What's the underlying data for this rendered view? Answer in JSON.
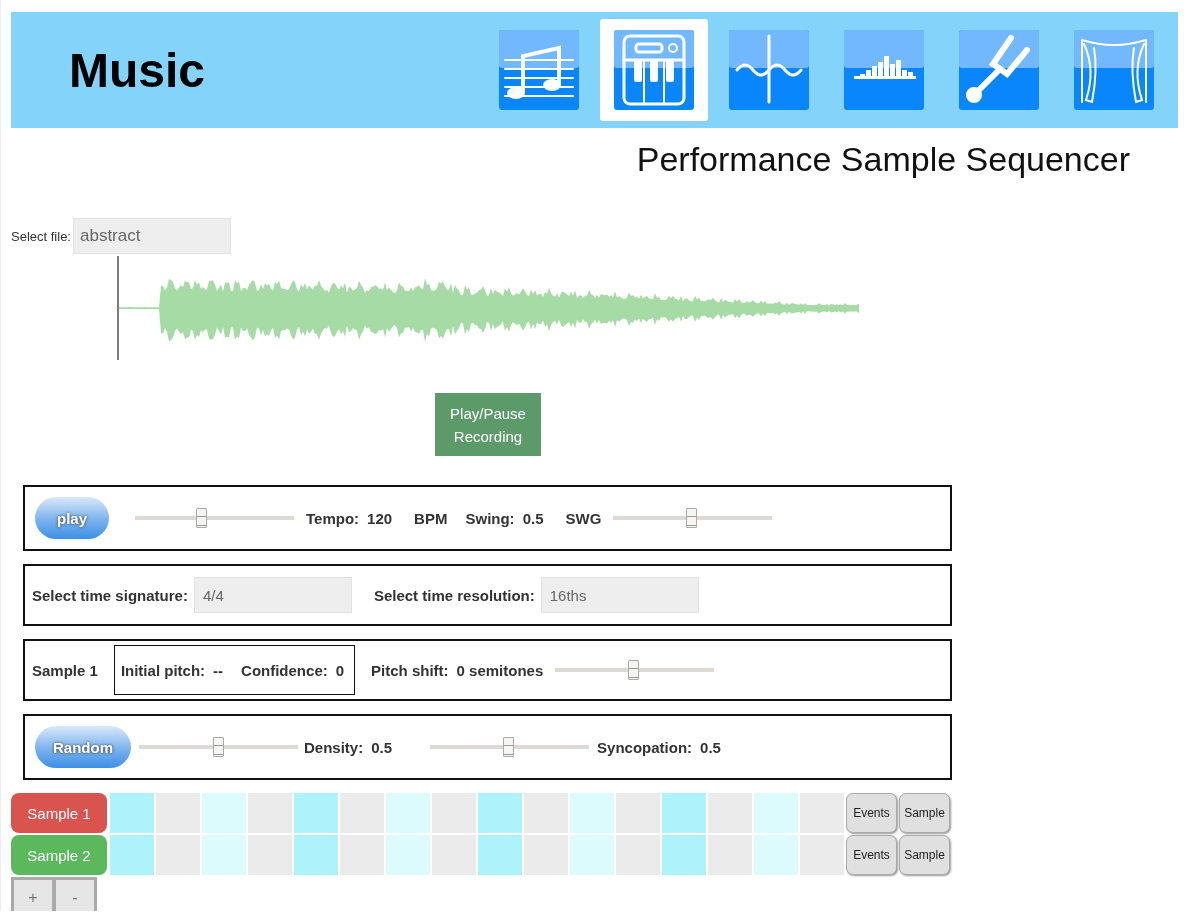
{
  "header": {
    "title": "Music",
    "tabs": [
      {
        "kind": "notes",
        "selected": false
      },
      {
        "kind": "keyboard",
        "selected": true
      },
      {
        "kind": "wave",
        "selected": false
      },
      {
        "kind": "equalizer",
        "selected": false
      },
      {
        "kind": "tuning-fork",
        "selected": false
      },
      {
        "kind": "curtain",
        "selected": false
      }
    ]
  },
  "page_title": "Performance Sample Sequencer",
  "file": {
    "label": "Select file:",
    "value": "abstract"
  },
  "recording_button": "Play/Pause Recording",
  "transport": {
    "play_button": "play",
    "tempo_slider": {
      "level": 0.41
    },
    "tempo_label": "Tempo:",
    "tempo_value": "120",
    "tempo_unit": "BPM",
    "swing_label": "Swing:",
    "swing_value": "0.5",
    "swing_unit": "SWG",
    "swing_slider": {
      "level": 0.49
    }
  },
  "timing": {
    "signature_label": "Select time signature:",
    "signature_value": "4/4",
    "resolution_label": "Select time resolution:",
    "resolution_value": "16ths"
  },
  "sample_info": {
    "name": "Sample 1",
    "pitch_label": "Initial pitch:",
    "pitch_value": "--",
    "confidence_label": "Confidence:",
    "confidence_value": "0",
    "shift_label": "Pitch shift:",
    "shift_value": "0 semitones",
    "shift_slider": {
      "level": 0.49
    }
  },
  "random": {
    "button": "Random",
    "density_slider": {
      "level": 0.5
    },
    "density_label": "Density:",
    "density_value": "0.5",
    "syncopation_slider": {
      "level": 0.49
    },
    "syncopation_label": "Syncopation:",
    "syncopation_value": "0.5"
  },
  "tracks": [
    {
      "name": "Sample 1",
      "color": "#d9534f",
      "events_button": "Events",
      "sample_button": "Sample"
    },
    {
      "name": "Sample 2",
      "color": "#5cb85c",
      "events_button": "Events",
      "sample_button": "Sample"
    }
  ],
  "add_button": "+",
  "remove_button": "-"
}
